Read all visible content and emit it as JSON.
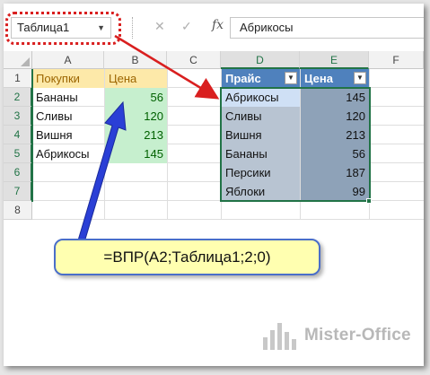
{
  "formula_bar": {
    "name_box": "Таблица1",
    "name_box_dropdown": "▼",
    "cancel_glyph": "✕",
    "enter_glyph": "✓",
    "fx_label": "fx",
    "value": "Абрикосы"
  },
  "columns": [
    "A",
    "B",
    "C",
    "D",
    "E",
    "F"
  ],
  "rows": [
    "1",
    "2",
    "3",
    "4",
    "5",
    "6",
    "7",
    "8"
  ],
  "left_table": {
    "headers": [
      "Покупки",
      "Цена"
    ],
    "rows": [
      [
        "Бананы",
        "56"
      ],
      [
        "Сливы",
        "120"
      ],
      [
        "Вишня",
        "213"
      ],
      [
        "Абрикосы",
        "145"
      ]
    ]
  },
  "right_table": {
    "name": "Таблица1",
    "headers": [
      "Прайс",
      "Цена"
    ],
    "filter_glyph": "▼",
    "rows": [
      [
        "Абрикосы",
        "145"
      ],
      [
        "Сливы",
        "120"
      ],
      [
        "Вишня",
        "213"
      ],
      [
        "Бананы",
        "56"
      ],
      [
        "Персики",
        "187"
      ],
      [
        "Яблоки",
        "99"
      ]
    ]
  },
  "callout": {
    "formula": "=ВПР(A2;Таблица1;2;0)"
  },
  "logo": {
    "text": "Mister-Office"
  },
  "colors": {
    "excel_green": "#217346",
    "table_header_blue": "#4f81bd",
    "annotation_red": "#d91f1f",
    "arrow_blue": "#2a3fd6",
    "callout_fill": "#ffffb0"
  }
}
